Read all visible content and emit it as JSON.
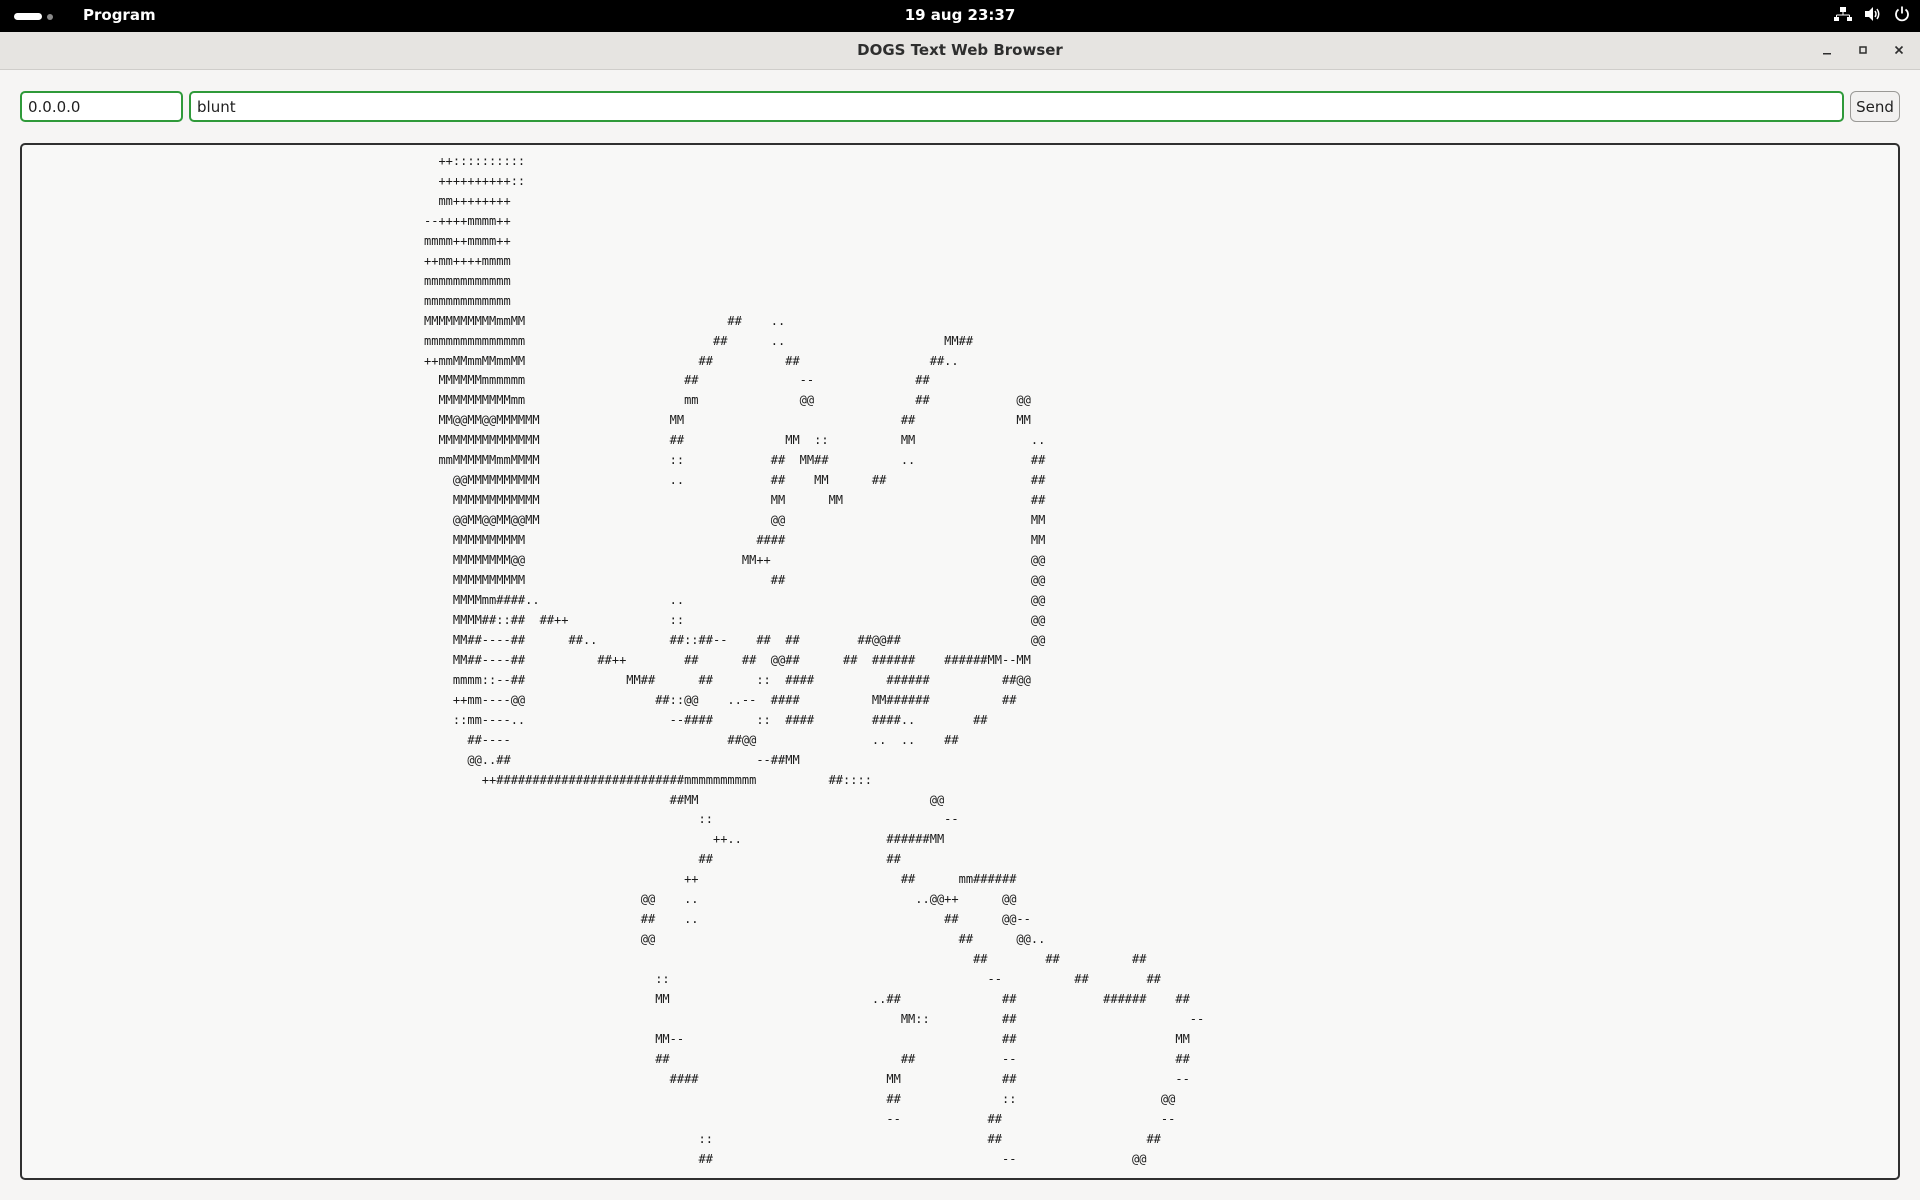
{
  "topbar": {
    "app_menu": "Program",
    "clock": "19 aug  23:37"
  },
  "window": {
    "title": "DOGS Text Web Browser"
  },
  "address": {
    "host": "0.0.0.0",
    "path": "blunt",
    "send_label": "Send"
  },
  "content": {
    "ascii_art": "  ++::::::::::\n  ++++++++++::\n  mm++++++++\n--++++mmmm++\nmmmm++mmmm++\n++mm++++mmmm\nmmmmmmmmmmmm\nmmmmmmmmmmmm\nMMMMMMMMMMmmMM                            ##    ..\nmmmmmmmmmmmmmm                          ##      ..                      MM##\n++mmMMmmMMmmMM                        ##          ##                  ##..\n  MMMMMMmmmmmm                      ##              --              ##\n  MMMMMMMMMMmm                      mm              @@              ##            @@\n  MM@@MM@@MMMMMM                  MM                              ##              MM\n  MMMMMMMMMMMMMM                  ##              MM  ::          MM                ..\n  mmMMMMMMmmMMMM                  ::            ##  MM##          ..                ##\n    @@MMMMMMMMMM                  ..            ##    MM      ##                    ##\n    MMMMMMMMMMMM                                MM      MM                          ##\n    @@MM@@MM@@MM                                @@                                  MM\n    MMMMMMMMMM                                ####                                  MM\n    MMMMMMMM@@                              MM++                                    @@\n    MMMMMMMMMM                                  ##                                  @@\n    MMMMmm####..                  ..                                                @@\n    MMMM##::##  ##++              ::                                                @@\n    MM##----##      ##..          ##::##--    ##  ##        ##@@##                  @@\n    MM##----##          ##++        ##      ##  @@##      ##  ######    ######MM--MM\n    mmmm::--##              MM##      ##      ::  ####          ######          ##@@\n    ++mm----@@                  ##::@@    ..--  ####          MM######          ##\n    ::mm----..                    --####      ::  ####        ####..        ##\n      ##----                              ##@@                ..  ..    ##\n      @@..##                                  --##MM\n        ++##########################mmmmmmmmmm          ##::::\n                                  ##MM                                @@\n                                      ::                                --\n                                        ++..                    ######MM\n                                      ##                        ##\n                                    ++                            ##      mm######\n                              @@    ..                              ..@@++      @@\n                              ##    ..                                  ##      @@--\n                              @@                                          ##      @@..\n                                                                            ##        ##          ##\n                                ::                                            --          ##        ##\n                                MM                            ..##              ##            ######    ##\n                                                                  MM::          ##                        --\n                                MM--                                            ##                      MM\n                                ##                                ##            --                      ##\n                                  ####                          MM              ##                      --\n                                                                ##              ::                    @@\n                                                                --            ##                      --\n                                      ::                                      ##                    ##\n                                      ##                                        --                @@"
  }
}
